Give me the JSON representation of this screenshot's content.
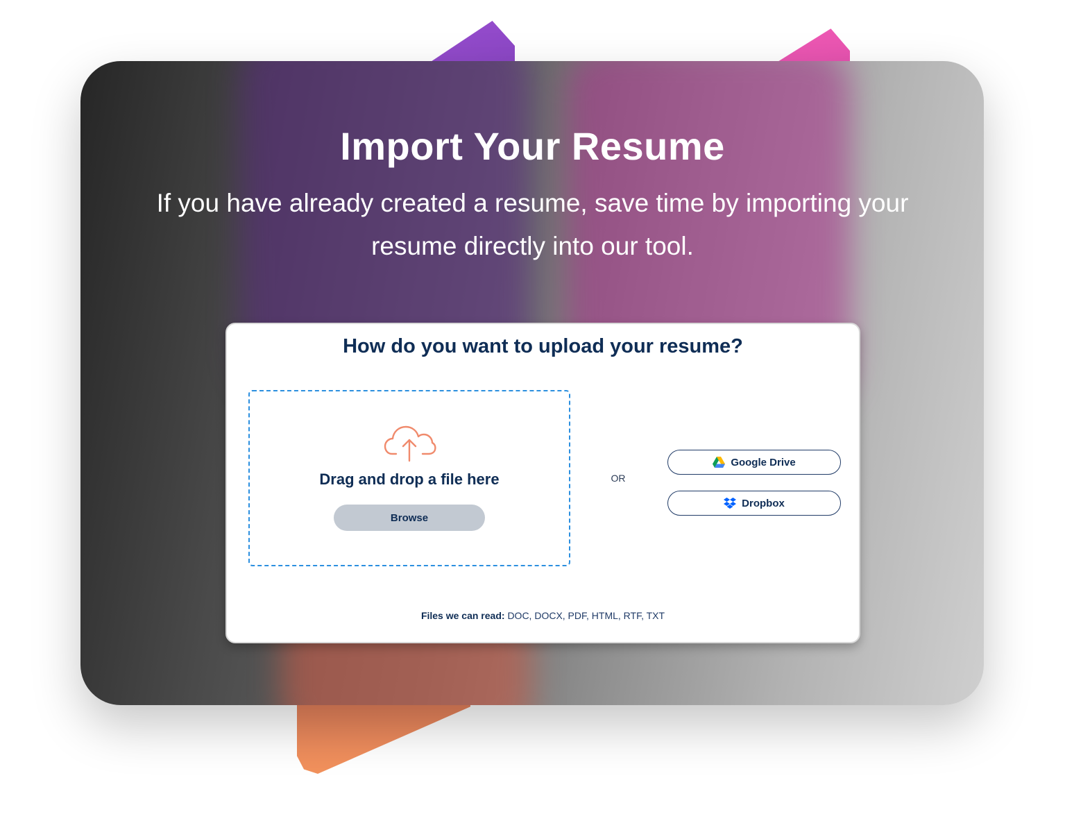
{
  "hero": {
    "title": "Import Your Resume",
    "subtitle": "If you have already created a resume, save time by importing your resume directly into our tool."
  },
  "upload": {
    "title": "How do you want to upload your resume?",
    "dropzone": {
      "icon": "cloud-upload-icon",
      "text": "Drag and drop a file here",
      "browse_label": "Browse"
    },
    "or_label": "OR",
    "providers": [
      {
        "label": "Google Drive",
        "icon": "google-drive-icon"
      },
      {
        "label": "Dropbox",
        "icon": "dropbox-icon"
      }
    ],
    "formats_label": "Files we can read:",
    "formats_value": "DOC, DOCX, PDF, HTML, RTF, TXT"
  },
  "colors": {
    "navy": "#0f2d55",
    "dropzone_border": "#2b8fdf",
    "browse_bg": "#c2c9d2",
    "upload_icon": "#f08a6c",
    "accent_purple": "#9a4ed0",
    "accent_pink": "#f05ab5",
    "accent_orange": "#f2925c"
  }
}
